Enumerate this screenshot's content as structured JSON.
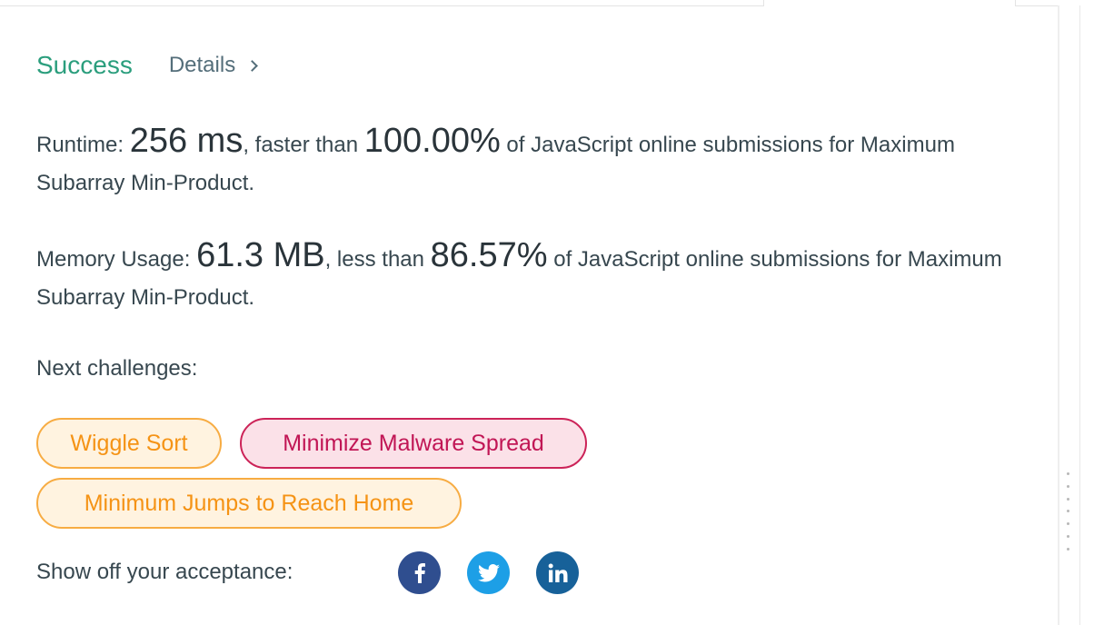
{
  "result": {
    "status": "Success",
    "details_label": "Details"
  },
  "runtime": {
    "label": "Runtime: ",
    "value": "256 ms",
    "comparison": ", faster than ",
    "percent": "100.00%",
    "suffix": " of JavaScript online submissions for Maximum Subarray Min-Product."
  },
  "memory": {
    "label": "Memory Usage: ",
    "value": "61.3 MB",
    "comparison": ", less than ",
    "percent": "86.57%",
    "suffix": " of JavaScript online submissions for Maximum Subarray Min-Product."
  },
  "next_challenges": {
    "label": "Next challenges:",
    "items": [
      {
        "label": "Wiggle Sort",
        "difficulty": "medium"
      },
      {
        "label": "Minimize Malware Spread",
        "difficulty": "hard"
      },
      {
        "label": "Minimum Jumps to Reach Home",
        "difficulty": "medium"
      }
    ]
  },
  "share": {
    "label": "Show off your acceptance:",
    "icons": [
      "facebook-icon",
      "twitter-icon",
      "linkedin-icon"
    ]
  },
  "colors": {
    "success": "#2b9e7d",
    "medium": "#f59315",
    "hard": "#c11655",
    "facebook": "#2f4e8f",
    "twitter": "#1d9fe6",
    "linkedin": "#176199"
  }
}
